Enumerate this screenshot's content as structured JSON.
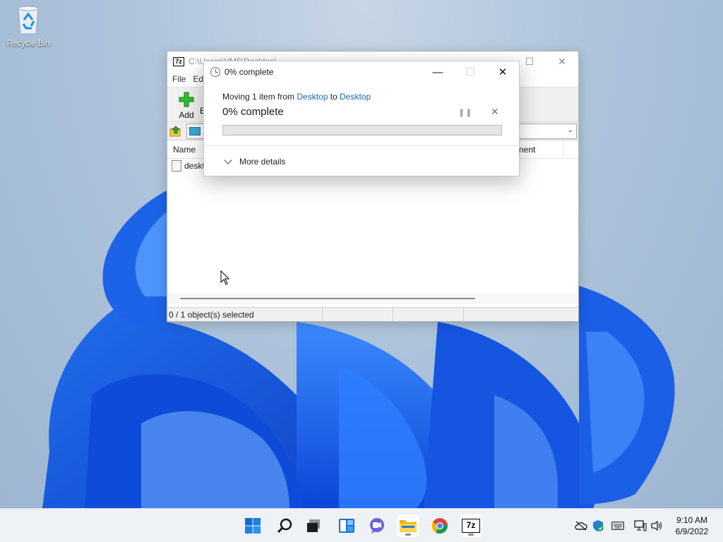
{
  "desktop": {
    "recycle_bin_label": "Recycle Bin"
  },
  "zip_window": {
    "app_icon_text": "7z",
    "title": "C:\\Users\\VM6\\Desktop\\",
    "menu": [
      "File",
      "Ed"
    ],
    "toolbar": {
      "add_label": "Add",
      "extract_label_partial": "E"
    },
    "columns": {
      "name": "Name",
      "comment_partial": "nent"
    },
    "file_item": "deskt",
    "status": {
      "selected": "0 / 1 object(s) selected"
    }
  },
  "progress_dialog": {
    "title": "0% complete",
    "moving_prefix": "Moving 1 item from",
    "source": "Desktop",
    "to_word": "to",
    "destination": "Desktop",
    "percent_text": "0% complete",
    "progress_fraction": 0,
    "more_details": "More details",
    "colors": {
      "link": "#1a66b8",
      "progress_fill": "#06b025"
    }
  },
  "taskbar": {
    "icons": [
      "start-icon",
      "search-icon",
      "task-view-icon",
      "widgets-icon",
      "chat-icon",
      "file-explorer-icon",
      "chrome-icon",
      "7zip-icon"
    ],
    "seven_zip_text": "7z",
    "tray_icons": [
      "onedrive-offline-icon",
      "security-icon",
      "keyboard-icon",
      "network-icon",
      "volume-icon"
    ],
    "time": "9:10 AM",
    "date": "6/9/2022"
  }
}
